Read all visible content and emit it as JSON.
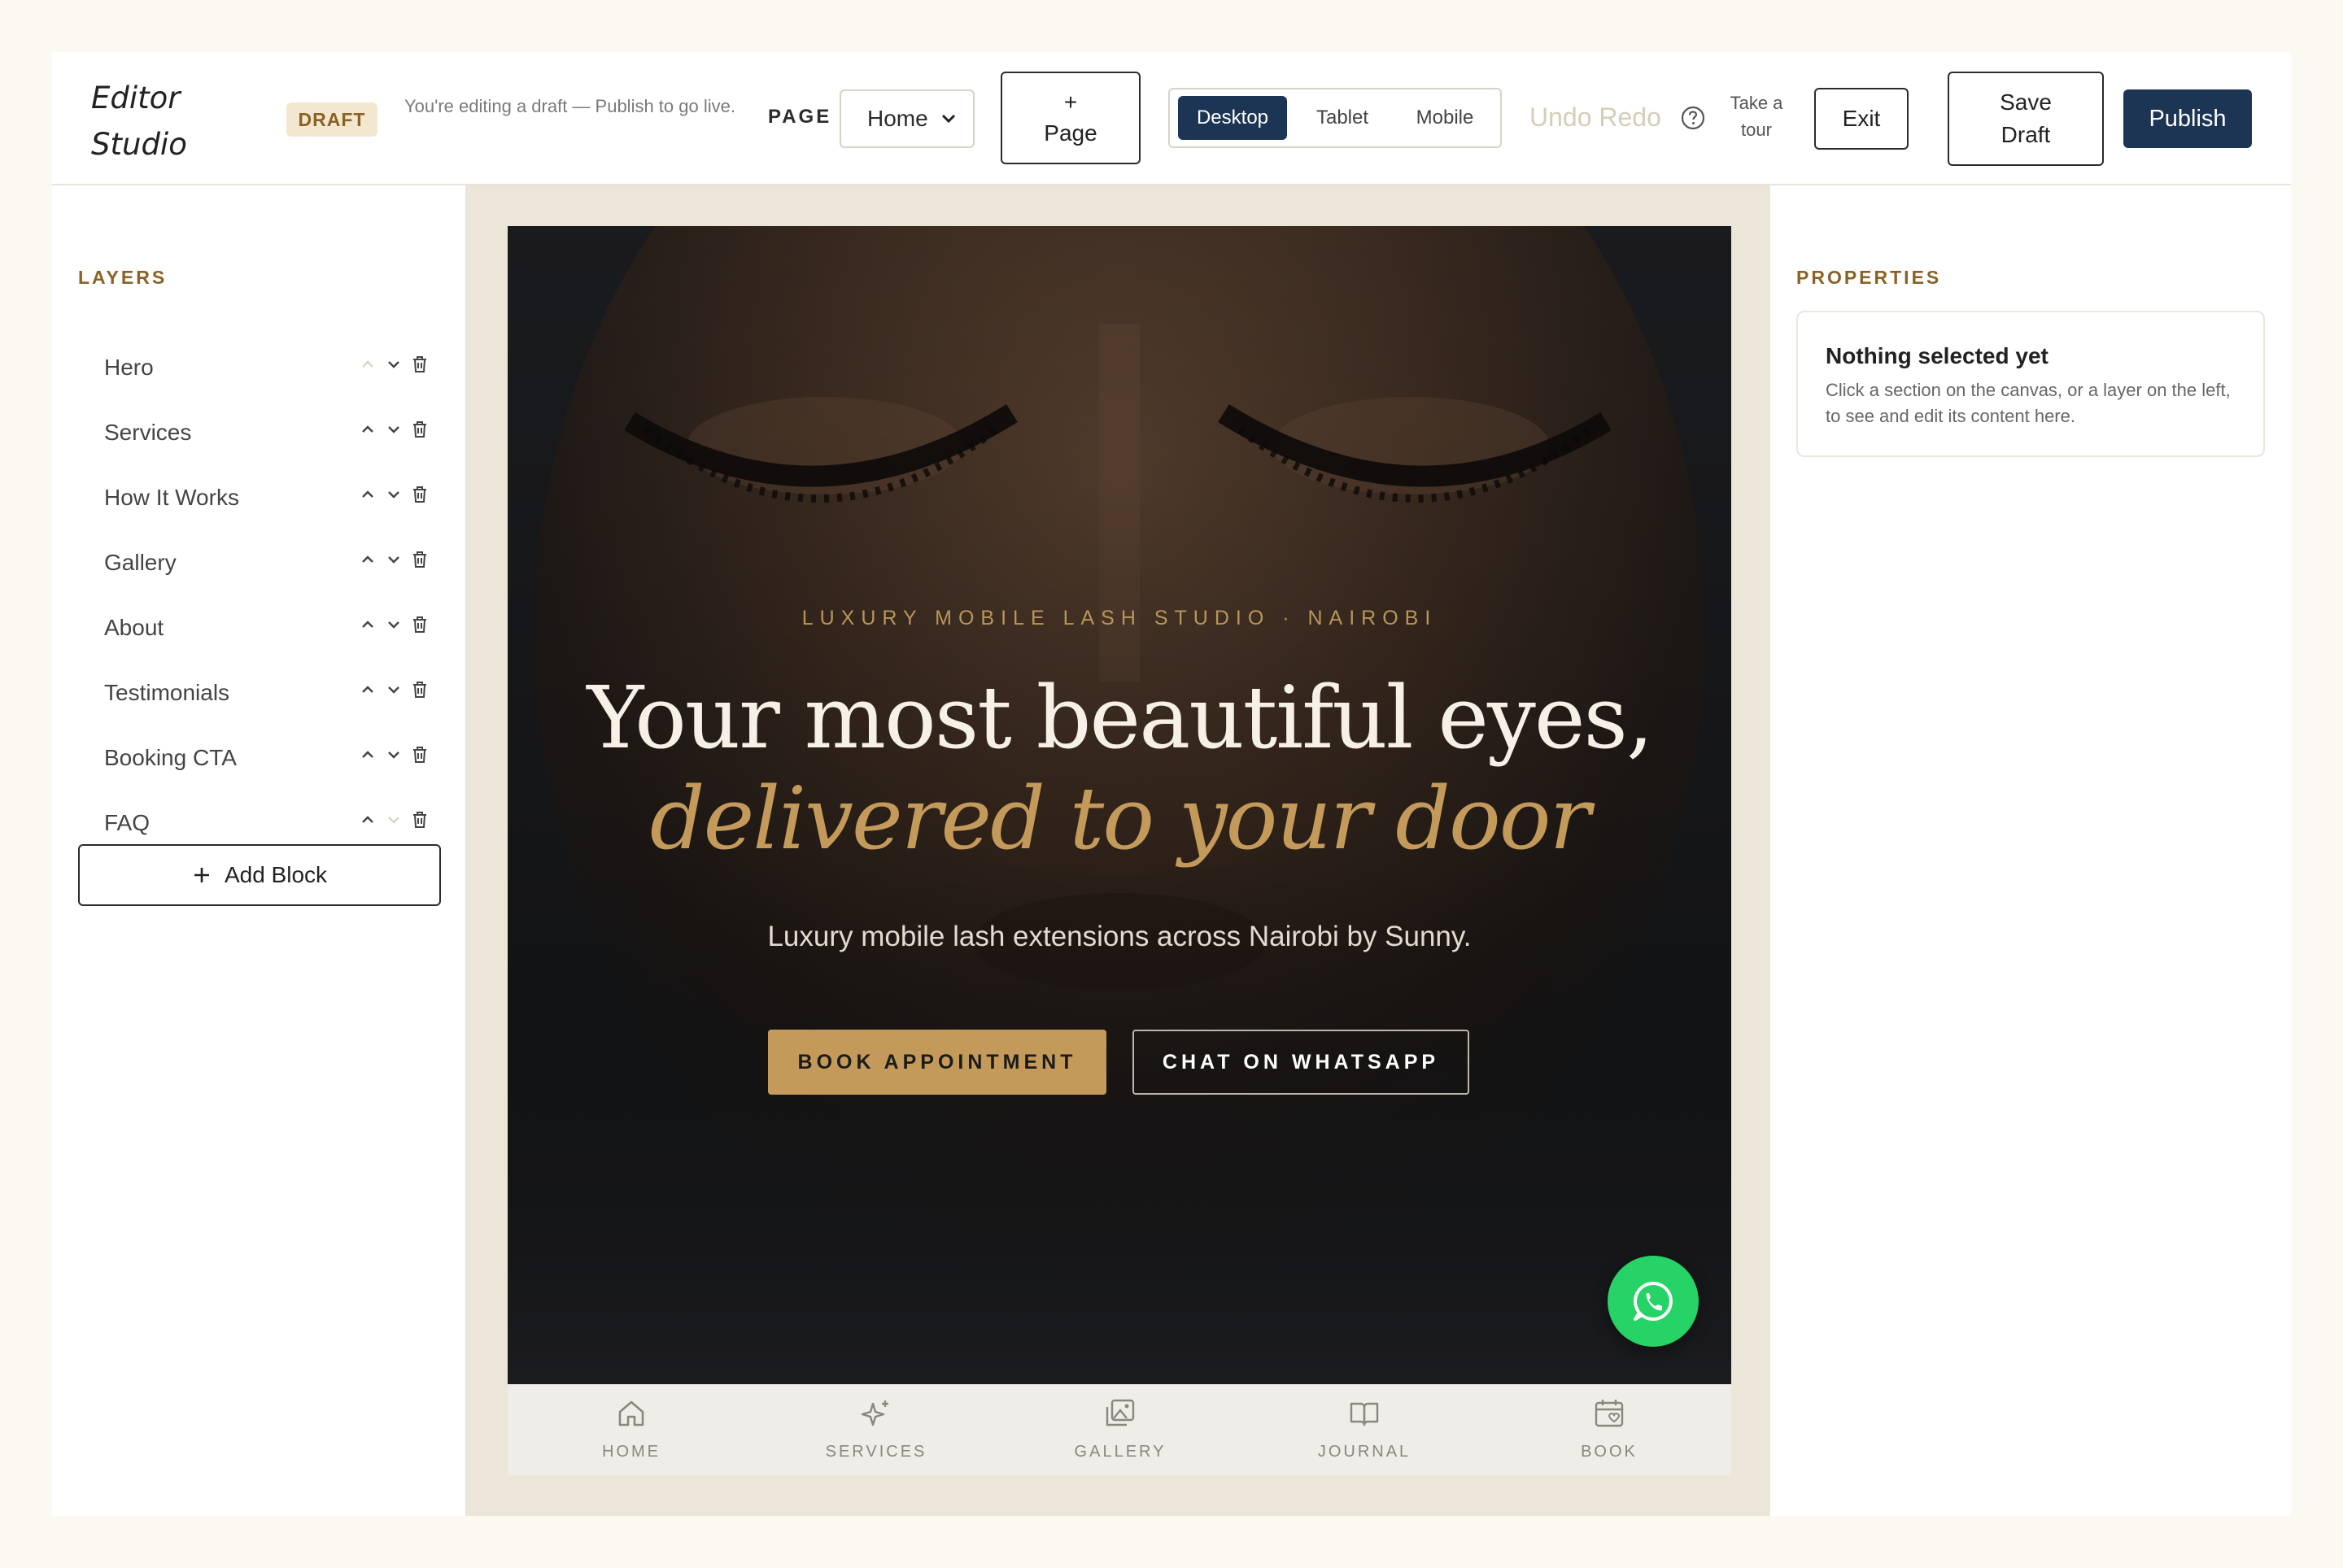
{
  "topbar": {
    "brand": "Editor Studio",
    "draft_badge": "DRAFT",
    "draft_note": "You're editing a draft — Publish to go live.",
    "page_label": "PAGE",
    "page_select": "Home",
    "add_page_plus": "+",
    "add_page_label": "Page",
    "devices": [
      "Desktop",
      "Tablet",
      "Mobile"
    ],
    "active_device": "Desktop",
    "undo_redo": "Undo Redo",
    "help_icon": "question-circle-icon",
    "tour": "Take a tour",
    "exit": "Exit",
    "save_draft": "Save Draft",
    "publish": "Publish"
  },
  "layers": {
    "title": "LAYERS",
    "items": [
      {
        "label": "Hero"
      },
      {
        "label": "Services"
      },
      {
        "label": "How It Works"
      },
      {
        "label": "Gallery"
      },
      {
        "label": "About"
      },
      {
        "label": "Testimonials"
      },
      {
        "label": "Booking CTA"
      },
      {
        "label": "FAQ"
      }
    ],
    "add_block": "Add Block"
  },
  "hero": {
    "eyebrow": "LUXURY MOBILE LASH STUDIO · NAIROBI",
    "headline": "Your most beautiful eyes,",
    "headline_italic": "delivered to your door",
    "subtext": "Luxury mobile lash extensions across Nairobi by Sunny.",
    "book_button": "BOOK APPOINTMENT",
    "chat_button": "CHAT ON WHATSAPP",
    "fab_icon": "whatsapp-icon"
  },
  "bottom_nav": [
    {
      "label": "HOME",
      "icon": "home-icon"
    },
    {
      "label": "SERVICES",
      "icon": "sparkle-icon"
    },
    {
      "label": "GALLERY",
      "icon": "gallery-icon"
    },
    {
      "label": "JOURNAL",
      "icon": "book-open-icon"
    },
    {
      "label": "BOOK",
      "icon": "calendar-heart-icon"
    }
  ],
  "properties": {
    "title": "PROPERTIES",
    "empty_title": "Nothing selected yet",
    "empty_desc": "Click a section on the canvas, or a layer on the left, to see and edit its content here."
  },
  "colors": {
    "accent_gold": "#c49a5a",
    "navy": "#1d3555",
    "whatsapp_green": "#25d366",
    "canvas_bg": "#ece6d9"
  }
}
